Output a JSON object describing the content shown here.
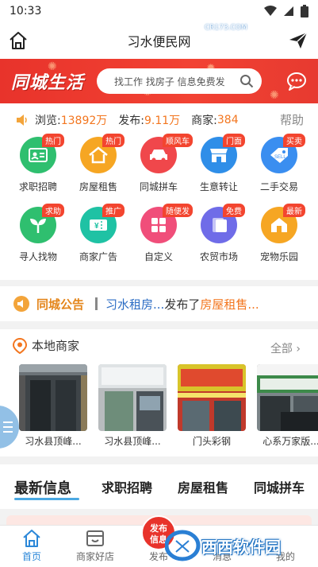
{
  "status_bar": {
    "time": "10:33"
  },
  "nav": {
    "title": "习水便民网"
  },
  "banner": {
    "brand": "同城生活",
    "search_placeholder": "找工作 找房子 信息免费发"
  },
  "stats": {
    "views_label": "浏览:",
    "views": "13892万",
    "posts_label": "发布:",
    "posts": "9.11万",
    "merchants_label": "商家:",
    "merchants": "384",
    "help": "帮助"
  },
  "categories": [
    {
      "label": "求职招聘",
      "tag": "热门",
      "color": "#2fbf6f",
      "icon": "id-card-icon"
    },
    {
      "label": "房屋租售",
      "tag": "热门",
      "color": "#f6a623",
      "icon": "house-icon"
    },
    {
      "label": "同城拼车",
      "tag": "顺风车",
      "color": "#f0474b",
      "icon": "car-icon"
    },
    {
      "label": "生意转让",
      "tag": "门面",
      "color": "#2f8ee8",
      "icon": "shop-icon"
    },
    {
      "label": "二手交易",
      "tag": "买卖",
      "color": "#3a8ef0",
      "icon": "price-tag-icon"
    },
    {
      "label": "寻人找物",
      "tag": "求助",
      "color": "#2fbf6f",
      "icon": "sprout-icon"
    },
    {
      "label": "商家广告",
      "tag": "推广",
      "color": "#1fc2a4",
      "icon": "ticket-icon"
    },
    {
      "label": "自定义",
      "tag": "随便发",
      "color": "#f04e7a",
      "icon": "grid-icon"
    },
    {
      "label": "农贸市场",
      "tag": "免费",
      "color": "#6f6ce8",
      "icon": "cards-icon"
    },
    {
      "label": "宠物乐园",
      "tag": "最新",
      "color": "#f6a623",
      "icon": "pet-house-icon"
    }
  ],
  "notice": {
    "title": "同城公告",
    "user": "习水租房...",
    "action": "发布了",
    "category": "房屋租售..."
  },
  "merchants": {
    "title": "本地商家",
    "all": "全部 ›",
    "items": [
      {
        "name": "习水县顶峰..."
      },
      {
        "name": "习水县顶峰..."
      },
      {
        "name": "门头彩钢"
      },
      {
        "name": "心系万家版..."
      }
    ]
  },
  "tabs": [
    {
      "label": "最新信息",
      "active": true
    },
    {
      "label": "求职招聘",
      "active": false
    },
    {
      "label": "房屋租售",
      "active": false
    },
    {
      "label": "同城拼车",
      "active": false
    }
  ],
  "bottom_nav": [
    {
      "label": "首页",
      "active": true
    },
    {
      "label": "商家好店",
      "active": false
    },
    {
      "label": "发布",
      "active": false
    },
    {
      "label": "消息",
      "active": false
    },
    {
      "label": "我的",
      "active": false
    }
  ],
  "publish": {
    "line1": "发布",
    "line2": "信息"
  },
  "watermark": {
    "text": "西西软件园",
    "sub": "CR173.COM"
  }
}
